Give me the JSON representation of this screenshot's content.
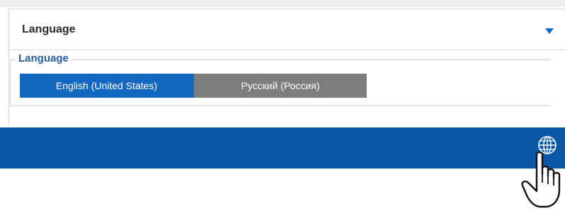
{
  "panel": {
    "title": "Language",
    "collapse_icon": "triangle-down-icon"
  },
  "language_group": {
    "legend": "Language",
    "options": [
      {
        "label": "English (United States)",
        "selected": true
      },
      {
        "label": "Русский (Россия)",
        "selected": false
      }
    ]
  },
  "bottom_bar": {
    "globe_icon": "globe-icon",
    "cursor": "hand-pointer-cursor"
  },
  "colors": {
    "accent": "#1467c0",
    "bar": "#0c58a6",
    "inactive": "#7d7d7d",
    "legend": "#1f5fa0"
  }
}
